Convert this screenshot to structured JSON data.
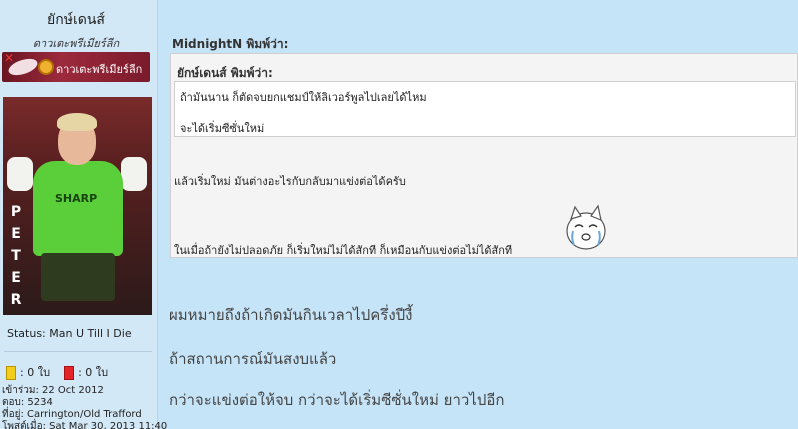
{
  "user": {
    "name": "ยักษ์เดนส์",
    "title": "ดาวเตะพรีเมียร์ลีก",
    "rank_badge": "ดาวเตะพรีเมียร์ลีก",
    "avatar_letters": [
      "P",
      "E",
      "T",
      "E",
      "R"
    ],
    "avatar_sponsor": "SHARP",
    "status": "Status: Man U Till I Die",
    "yellow_cards": ": 0 ใบ",
    "red_cards": ": 0 ใบ",
    "joined": "เข้าร่วม: 22 Oct 2012",
    "posts": "ตอบ: 5234",
    "location": "ที่อยู่: Carrington/Old Trafford",
    "last_line": "โพสต์เมื่อ: Sat Mar 30, 2013 11:40"
  },
  "post": {
    "outer_quote_author": "MidnightN พิมพ์ว่า:",
    "inner_quote_author": "ยักษ์เดนส์ พิมพ์ว่า:",
    "inner_quote_lines": [
      "ถ้ามันนาน ก็ตัดจบยกแชมป์ให้ลิเวอร์พูลไปเลยได้ไหม",
      "จะได้เริ่มซีซั่นใหม่"
    ],
    "outer_quote_lines": [
      "แล้วเริ่มใหม่ มันต่างอะไรกับกลับมาแข่งต่อได้ครับ",
      "ในเมื่อถ้ายังไม่ปลอดภัย ก็เริ่มใหม่ไม่ได้สักที ก็เหมือนกับแข่งต่อไม่ได้สักที"
    ],
    "body_lines": [
      "ผมหมายถึงถ้าเกิดมันกินเวลาไปครึ่งปีงี้",
      "ถ้าสถานการณ์มันสงบแล้ว",
      "กว่าจะแข่งต่อให้จบ กว่าจะได้เริ่มซีซั่นใหม่ ยาวไปอีก"
    ]
  },
  "colors": {
    "page_bg": "#c6e4f7",
    "quote_bg": "#f4f4f4",
    "yellow_card": "#f2cd1a",
    "red_card": "#e5242a",
    "rank_badge": "#9c2a3c",
    "jersey": "#5bcf3a"
  }
}
